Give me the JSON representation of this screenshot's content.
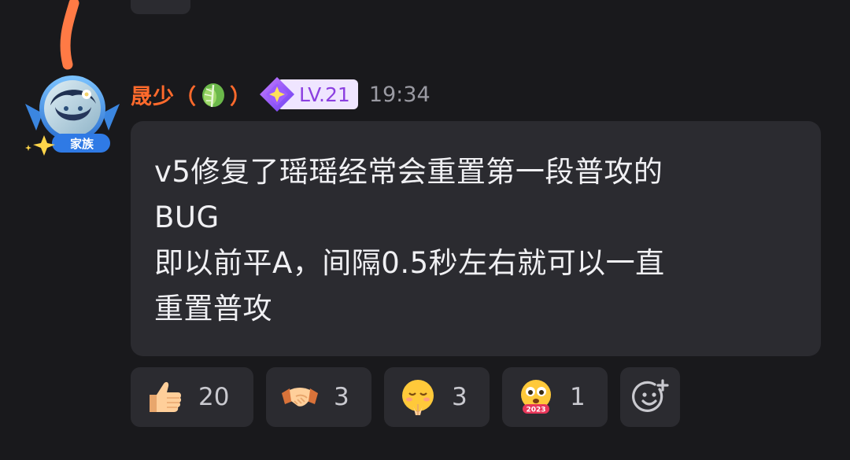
{
  "message": {
    "sender": {
      "name": "晟少",
      "paren_open": "（",
      "paren_close": "）",
      "avatar_badge": "家族",
      "name_color": "#ff6a2c"
    },
    "level_badge": "LV.21",
    "time": "19:34",
    "lines": [
      "v5修复了瑶瑶经常会重置第一段普攻的",
      "BUG",
      "即以前平A，间隔0.5秒左右就可以一直",
      "重置普攻"
    ]
  },
  "reactions": [
    {
      "icon": "thumbs-up-emoji",
      "count": "20"
    },
    {
      "icon": "handshake-emoji",
      "count": "3"
    },
    {
      "icon": "pleading-face-emoji",
      "count": "3"
    },
    {
      "icon": "surprised-2023-emoji",
      "count": "1"
    }
  ],
  "add_reaction_icon": "add-emoji-icon",
  "colors": {
    "background": "#19191c",
    "bubble": "#2b2b30",
    "level_text": "#8b3fe0",
    "level_bg": "#efe5ff"
  },
  "avatar_badge_text": "家族",
  "emoji_2023_text": "2023"
}
